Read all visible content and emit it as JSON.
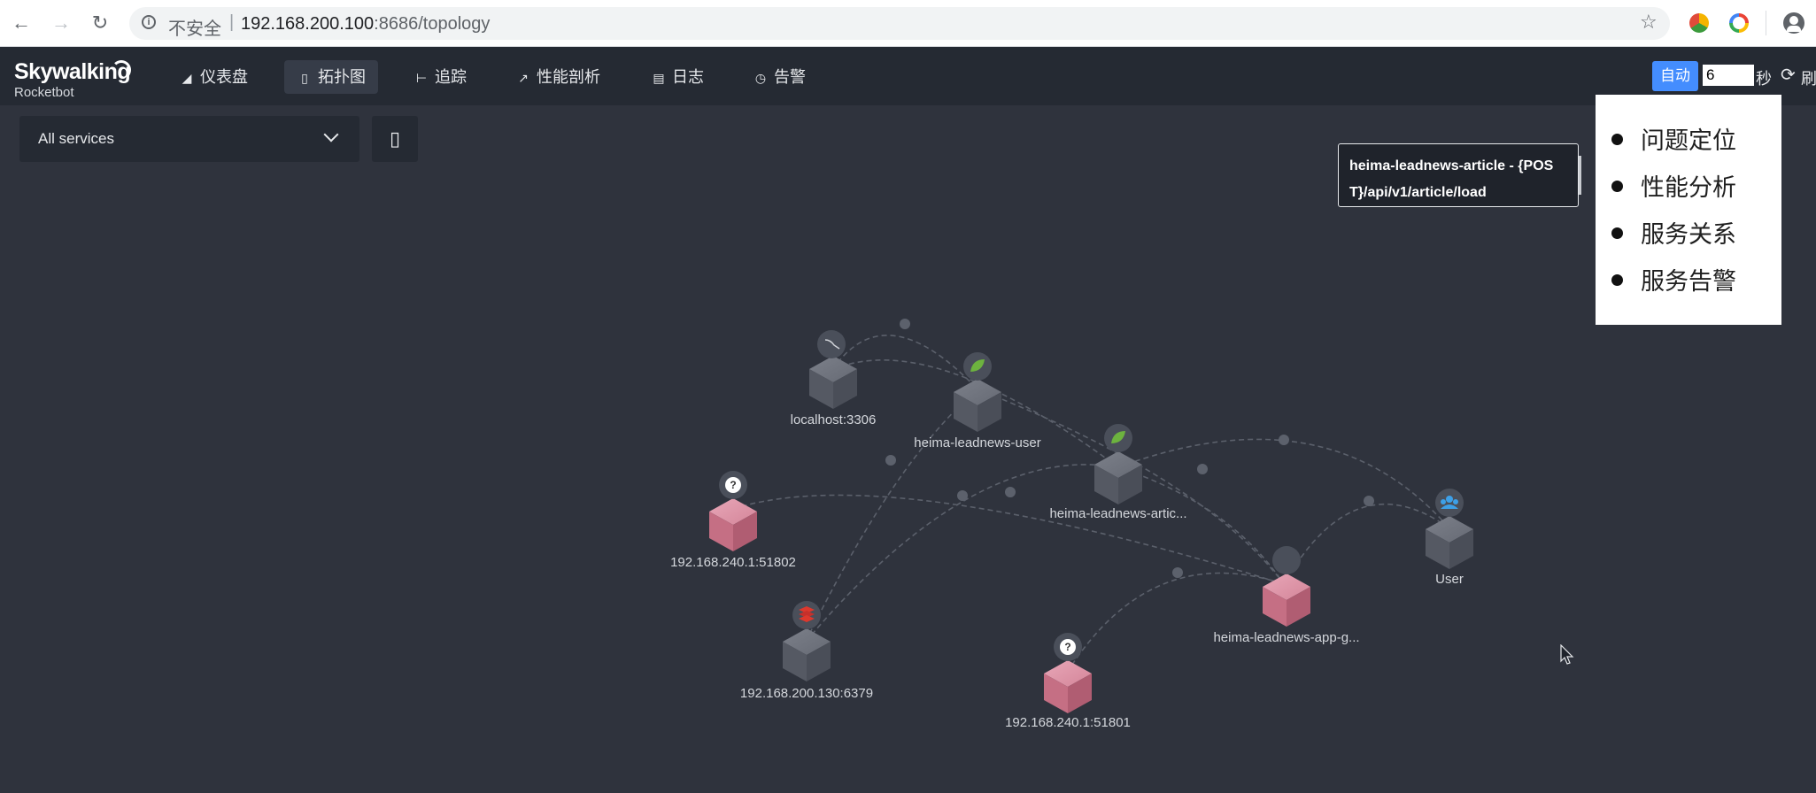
{
  "browser": {
    "insecure_label": "不安全",
    "separator": "|",
    "url_host": "192.168.200.100",
    "url_path": ":8686/topology"
  },
  "app": {
    "logo": "Skywalking",
    "logo_sub": "Rocketbot",
    "nav": [
      {
        "label": "仪表盘",
        "icon": "chart-icon"
      },
      {
        "label": "拓扑图",
        "icon": "topology-icon",
        "active": true
      },
      {
        "label": "追踪",
        "icon": "trace-icon"
      },
      {
        "label": "性能剖析",
        "icon": "profile-icon"
      },
      {
        "label": "日志",
        "icon": "log-icon"
      },
      {
        "label": "告警",
        "icon": "alarm-icon"
      }
    ],
    "auto_label": "自动",
    "interval_value": "6",
    "seconds_label": "秒",
    "refresh_label": "刷"
  },
  "toolbar": {
    "service_select": "All services"
  },
  "tooltip": {
    "text": "heima-leadnews-article - {POST}/api/v1/article/load"
  },
  "menu": {
    "items": [
      "问题定位",
      "性能分析",
      "服务关系",
      "服务告警"
    ]
  },
  "topology": {
    "nodes": [
      {
        "label": "localhost:3306",
        "type": "mysql",
        "color": "gray"
      },
      {
        "label": "heima-leadnews-user",
        "type": "spring",
        "color": "gray"
      },
      {
        "label": "heima-leadnews-artic...",
        "type": "spring",
        "color": "gray"
      },
      {
        "label": "192.168.240.1:51802",
        "type": "unknown",
        "color": "pink"
      },
      {
        "label": "User",
        "type": "user",
        "color": "gray"
      },
      {
        "label": "heima-leadnews-app-g...",
        "type": "gateway",
        "color": "pink"
      },
      {
        "label": "192.168.200.130:6379",
        "type": "redis",
        "color": "gray"
      },
      {
        "label": "192.168.240.1:51801",
        "type": "unknown",
        "color": "pink"
      }
    ]
  }
}
